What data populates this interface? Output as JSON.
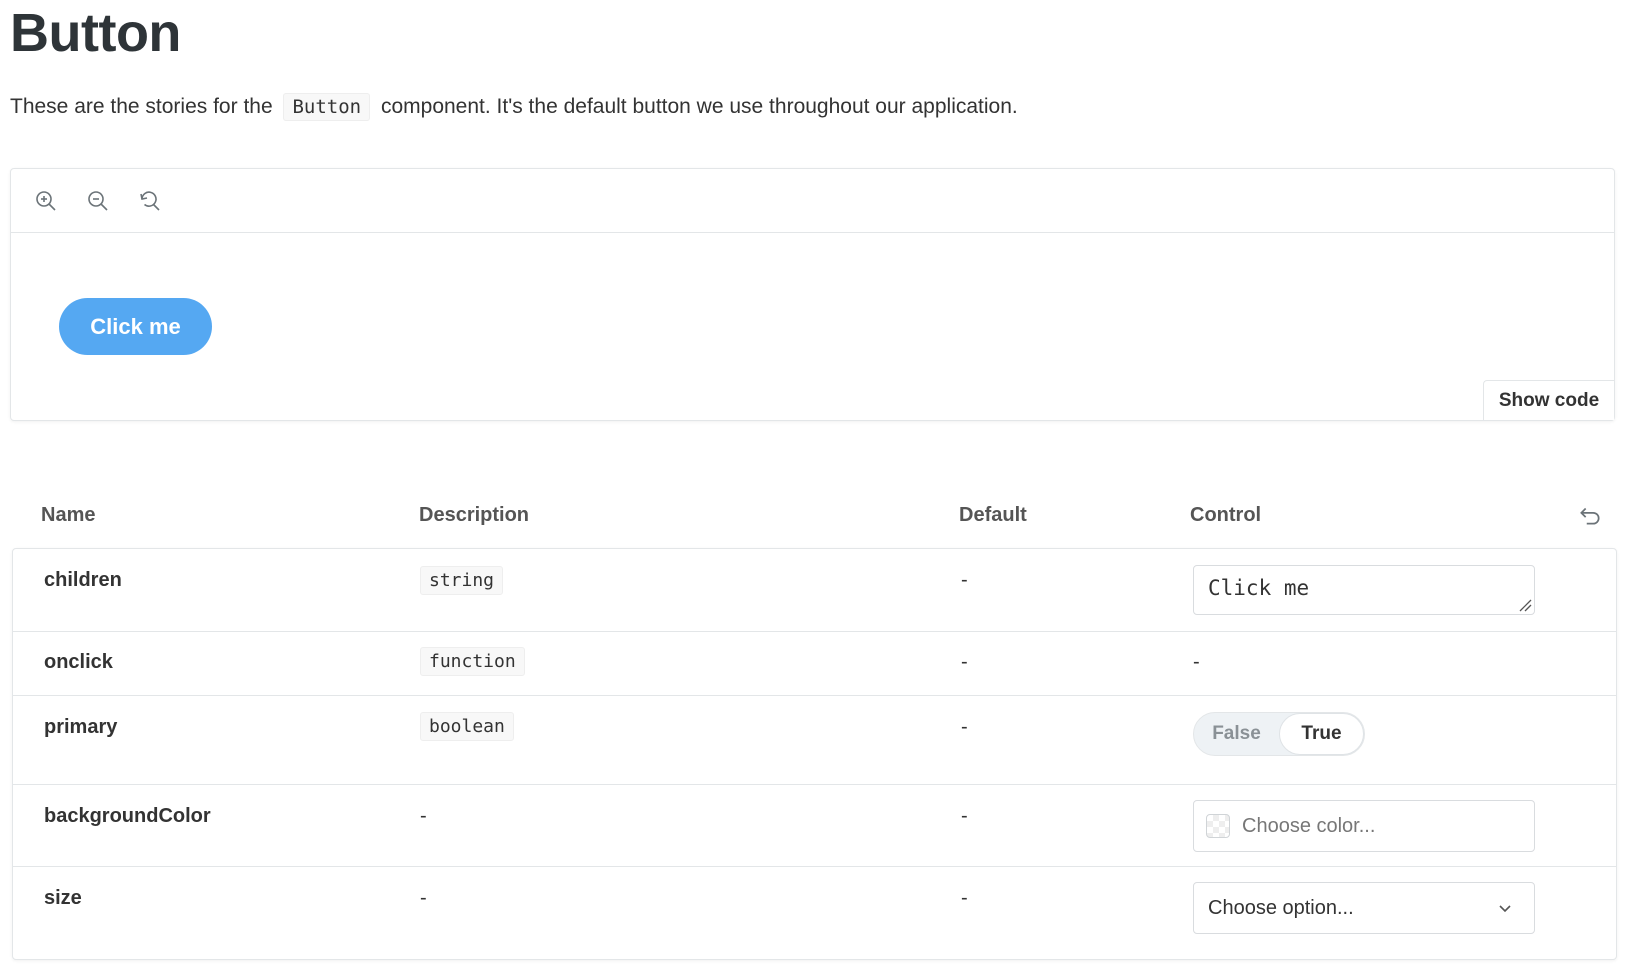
{
  "page": {
    "title": "Button",
    "intro_before": "These are the stories for the",
    "intro_code": "Button",
    "intro_after": "component. It's the default button we use throughout our application."
  },
  "preview": {
    "toolbar": [
      {
        "name": "zoom-in-icon"
      },
      {
        "name": "zoom-out-icon"
      },
      {
        "name": "reset-zoom-icon"
      }
    ],
    "demo_button_label": "Click me",
    "show_code_label": "Show code",
    "demo_button_color": "#55a8f2"
  },
  "args": {
    "headers": {
      "name": "Name",
      "description": "Description",
      "default": "Default",
      "control": "Control"
    },
    "rows": [
      {
        "name": "children",
        "type": "string",
        "default": "-",
        "control": {
          "kind": "text",
          "value": "Click me"
        }
      },
      {
        "name": "onclick",
        "type": "function",
        "default": "-",
        "control": {
          "kind": "none",
          "value": "-"
        }
      },
      {
        "name": "primary",
        "type": "boolean",
        "default": "-",
        "control": {
          "kind": "toggle",
          "options": [
            "False",
            "True"
          ],
          "selected": "True"
        }
      },
      {
        "name": "backgroundColor",
        "type": "-",
        "default": "-",
        "control": {
          "kind": "color",
          "placeholder": "Choose color..."
        }
      },
      {
        "name": "size",
        "type": "-",
        "default": "-",
        "control": {
          "kind": "select",
          "value": "Choose option..."
        }
      }
    ]
  }
}
